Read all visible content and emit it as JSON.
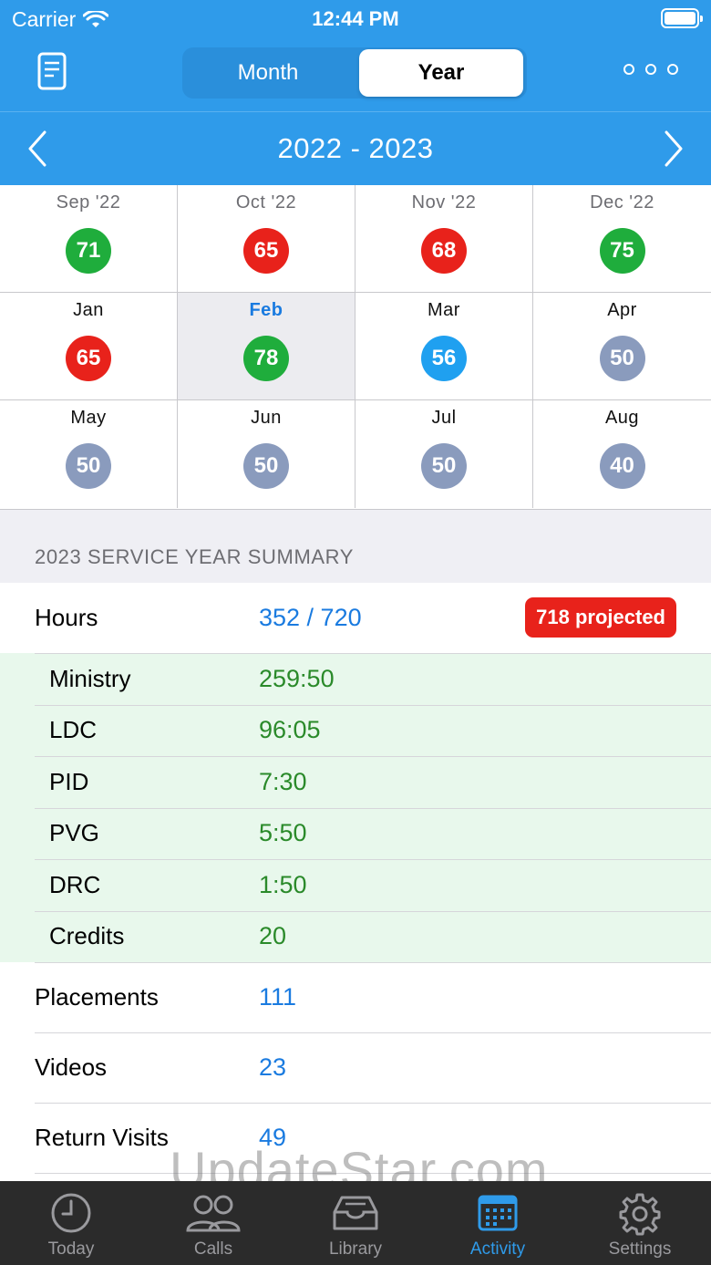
{
  "status": {
    "carrier": "Carrier",
    "time": "12:44 PM"
  },
  "segment": {
    "month": "Month",
    "year": "Year",
    "selected": "Year"
  },
  "year_title": "2022 - 2023",
  "colors": {
    "header": "#2f9bea",
    "green": "#1fad3c",
    "red": "#e8221b",
    "blue": "#1fa0f0",
    "gray": "#8a9bbd"
  },
  "months": [
    {
      "label": "Sep '22",
      "value": "71",
      "status": "green",
      "past": true
    },
    {
      "label": "Oct '22",
      "value": "65",
      "status": "red",
      "past": true
    },
    {
      "label": "Nov '22",
      "value": "68",
      "status": "red",
      "past": true
    },
    {
      "label": "Dec '22",
      "value": "75",
      "status": "green",
      "past": true
    },
    {
      "label": "Jan",
      "value": "65",
      "status": "red",
      "past": false
    },
    {
      "label": "Feb",
      "value": "78",
      "status": "green",
      "past": false,
      "selected": true
    },
    {
      "label": "Mar",
      "value": "56",
      "status": "blue",
      "past": false
    },
    {
      "label": "Apr",
      "value": "50",
      "status": "gray",
      "past": false
    },
    {
      "label": "May",
      "value": "50",
      "status": "gray",
      "past": false
    },
    {
      "label": "Jun",
      "value": "50",
      "status": "gray",
      "past": false
    },
    {
      "label": "Jul",
      "value": "50",
      "status": "gray",
      "past": false
    },
    {
      "label": "Aug",
      "value": "40",
      "status": "gray",
      "past": false
    }
  ],
  "summary": {
    "heading": "2023 SERVICE YEAR SUMMARY",
    "hours": {
      "label": "Hours",
      "value": "352 / 720",
      "projected": "718 projected"
    },
    "breakdown": [
      {
        "label": "Ministry",
        "value": "259:50"
      },
      {
        "label": "LDC",
        "value": "96:05"
      },
      {
        "label": "PID",
        "value": "7:30"
      },
      {
        "label": "PVG",
        "value": "5:50"
      },
      {
        "label": "DRC",
        "value": "1:50"
      },
      {
        "label": "Credits",
        "value": "20"
      }
    ],
    "placements": {
      "label": "Placements",
      "value": "111"
    },
    "videos": {
      "label": "Videos",
      "value": "23"
    },
    "return_visits": {
      "label": "Return Visits",
      "value": "49"
    }
  },
  "watermark": "UpdateStar.com",
  "tabs": [
    {
      "label": "Today",
      "icon": "clock-icon"
    },
    {
      "label": "Calls",
      "icon": "people-icon"
    },
    {
      "label": "Library",
      "icon": "tray-icon"
    },
    {
      "label": "Activity",
      "icon": "calendar-icon",
      "active": true
    },
    {
      "label": "Settings",
      "icon": "gear-icon"
    }
  ]
}
